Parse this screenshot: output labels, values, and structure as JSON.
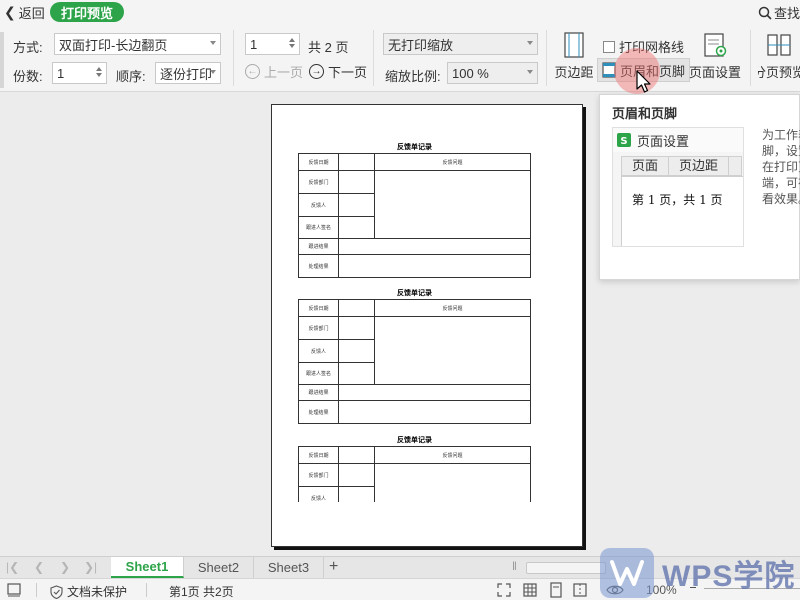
{
  "topbar": {
    "back_label": "返回",
    "mode_label": "打印预览",
    "search_label": "查找"
  },
  "ribbon": {
    "mode_label": "方式:",
    "mode_value": "双面打印-长边翻页",
    "copies_label": "份数:",
    "copies_value": "1",
    "order_label": "顺序:",
    "order_value": "逐份打印",
    "page_value": "1",
    "total_pages": "共 2 页",
    "prev_page": "上一页",
    "next_page": "下一页",
    "scale_mode": "无打印缩放",
    "zoom_label": "缩放比例:",
    "zoom_value": "100 %",
    "margins_label": "页边距",
    "gridlines_label": "打印网格线",
    "header_footer_label": "页眉和页脚",
    "page_setup_label": "页面设置",
    "page_break_label": "分页预览"
  },
  "preview": {
    "form_title": "反馈单记录",
    "row_labels": [
      "反馈日期",
      "反馈部门",
      "反馈人",
      "跟进人签名",
      "跟进结果",
      "处理结果"
    ],
    "problem_header": "反馈问题"
  },
  "tooltip": {
    "title": "页眉和页脚",
    "dialog_title": "页面设置",
    "tab_page": "页面",
    "tab_margins": "页边距",
    "sample_text": "第 1 页，共 1 页",
    "desc_lines": [
      "为工作表",
      "脚，设置",
      "在打印页",
      "端，可在",
      "看效果。"
    ]
  },
  "sheets": {
    "tabs": [
      "Sheet1",
      "Sheet2",
      "Sheet3"
    ],
    "add_label": "+"
  },
  "status": {
    "protect_label": "文档未保护",
    "page_info": "第1页 共2页",
    "zoom": "100%"
  },
  "watermark": {
    "text": "WPS学院"
  },
  "colors": {
    "accent": "#2ea44a",
    "highlight": "#f06e6e"
  }
}
